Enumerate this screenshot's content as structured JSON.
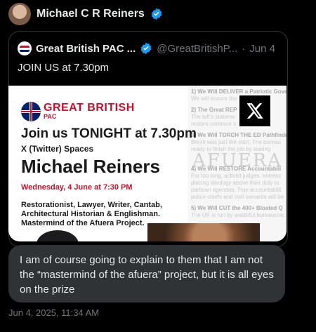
{
  "author": {
    "name": "Michael C R Reiners"
  },
  "quoted": {
    "name": "Great British PAC ...",
    "handle": "@GreatBritishP...",
    "separator": "·",
    "date": "Jun 4",
    "text": "JOIN US at 7.30pm"
  },
  "promo": {
    "brand": "GREAT BRITISH",
    "brand_sub": "PAC",
    "headline": "Join us TONIGHT at 7.30pm",
    "platform": "X (Twitter) Spaces",
    "speaker": "Michael Reiners",
    "date": "Wednesday, 4 June at 7:30 PM",
    "bio_lines": [
      "Restorationist, Lawyer, Writer, Cantab,",
      "Architectural Historian & Englishman.",
      "Mastermind of the Afuera Project."
    ],
    "background_watermark": "AFUERA",
    "background_lines": [
      "1) We Will DELIVER a Patriotic Gove",
      "We will ensure the",
      "2) The Great REP",
      "The left's stateme",
      "restore common s",
      "3) We Will TORCH THE ED Pathfinder",
      "Brexit was just the start. The bureau",
      "ready to finish the job by tearing",
      "4) We Will RESTORE Accountabili",
      "For too long, activist judges, entrenc",
      "placing ideology above their duty to",
      "partisan agendas. True accountabilit",
      "police chiefs and civil servants will be",
      "5) We Will CUT the 400+ Bloated Q",
      "The UK is run by wasteful bureaucrac"
    ]
  },
  "reply": {
    "text": "I am of course going to explain to them that I am not the “mastermind of the afuera” project, but it is all eyes on the prize"
  },
  "timestamp": "Jun 4, 2025, 11:34 AM",
  "colors": {
    "verified": "#1d9bf0",
    "brand_red": "#c8102e",
    "brand_blue": "#012169"
  }
}
